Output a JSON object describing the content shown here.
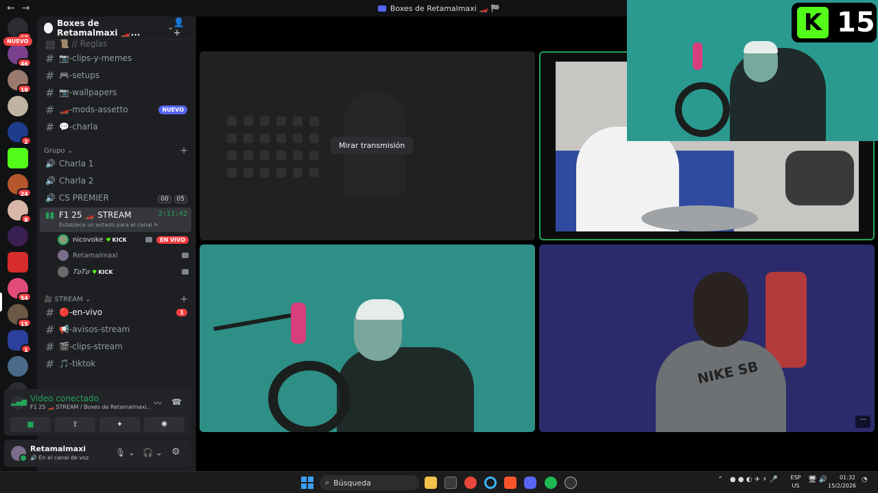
{
  "window": {
    "title": "Boxes de Retamalmaxi 🏎️ 🏁",
    "back": "←",
    "forward": "→"
  },
  "rail": {
    "nuevo_label": "NUEVO",
    "badges": [
      "67",
      "46",
      "18",
      "2",
      "24",
      "8",
      "54",
      "15",
      "1"
    ],
    "add_server": "+",
    "explore": "⊙"
  },
  "guild": {
    "name": "Boxes de Retamalmaxi 🏎️...",
    "chevron": "⌄",
    "invite": "👤+"
  },
  "channels": {
    "reglas": "📜 // Reglas",
    "text": [
      {
        "label": "📷-clips-y-memes"
      },
      {
        "label": "🎮-setups"
      },
      {
        "label": "📷-wallpapers"
      },
      {
        "label": "🏎️-mods-assetto",
        "badge": "NUEVO"
      },
      {
        "label": "💬-charla"
      }
    ],
    "group_category": "Grupo",
    "voice": [
      {
        "label": "Charla 1"
      },
      {
        "label": "Charla 2"
      },
      {
        "label": "CS PREMIER",
        "count_a": "00",
        "count_b": "05"
      }
    ],
    "active_voice": {
      "label": "F1 25 🏎️ STREAM",
      "timer": "2:11:42",
      "status": "Establece un estado para el canal ✎"
    },
    "users": [
      {
        "name": "nicovoke",
        "tag": "KICK",
        "live": "EN VIVO"
      },
      {
        "name": "Retamalmaxi"
      },
      {
        "name": "𝑻𝒐𝑻𝒐",
        "tag": "KICK"
      }
    ],
    "stream_category": "🎥 STREAM",
    "stream_channels": [
      {
        "label": "🔴-en-vivo",
        "badge": "1"
      },
      {
        "label": "📢-avisos-stream"
      },
      {
        "label": "🎬-clips-stream"
      },
      {
        "label": "🎵-tiktok"
      }
    ]
  },
  "voice_panel": {
    "status": "Video conectado",
    "channel": "F1 25 🏎️ STREAM / Boxes de Retamalmaxi...",
    "signal_icon": "▂▄▆",
    "noise_icon": "〰",
    "disconnect_icon": "☎",
    "buttons": [
      "■",
      "⇪",
      "✦",
      "✺"
    ]
  },
  "user_bar": {
    "name": "Retamalmaxi",
    "status": "🔊 En el canal de voz",
    "mic": "🎙 ⌄",
    "headset": "🎧 ⌄",
    "settings": "⚙"
  },
  "stage": {
    "watch_button": "Mirar transmisión",
    "more": "···",
    "kick_letter": "K",
    "kick_count": "15",
    "nike_text": "NIKE SB"
  },
  "taskbar": {
    "search_placeholder": "Búsqueda",
    "lang_top": "ESP",
    "lang_bottom": "US",
    "time": "01:32",
    "date": "15/2/2026"
  }
}
